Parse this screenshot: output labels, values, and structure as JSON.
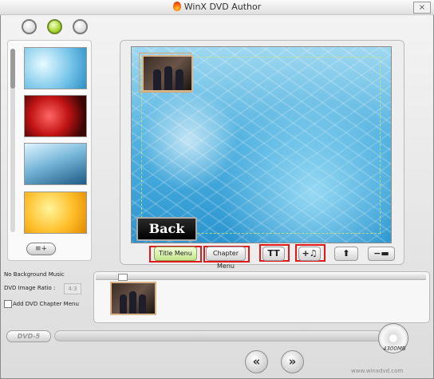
{
  "window": {
    "title": "WinX DVD Author",
    "close_label": "×"
  },
  "backgrounds": [
    {
      "name": "background-thumb-blue-mosaic"
    },
    {
      "name": "background-thumb-red-roses"
    },
    {
      "name": "background-thumb-blue-wave"
    },
    {
      "name": "background-thumb-yellow-flowers"
    }
  ],
  "preview": {
    "back_label": "Back"
  },
  "toolbar": {
    "title_menu_label": "Title Menu",
    "chapter_menu_label": "Chapter Menu",
    "text_icon_label": "TT",
    "add_music_label": "+♫",
    "up_label": "⬆",
    "minus_label": "−▬",
    "add_background_label": "≡+"
  },
  "settings": {
    "music_label": "No Background Music",
    "ratio_label": "DVD Image Ratio :",
    "ratio_value": "4:3",
    "chapter_menu_checkbox_label": "Add DVD Chapter Menu"
  },
  "bottom": {
    "dvd_type": "DVD-5",
    "capacity": "4300MB",
    "prev_label": "«",
    "next_label": "»",
    "watermark": "www.winxdvd.com"
  }
}
